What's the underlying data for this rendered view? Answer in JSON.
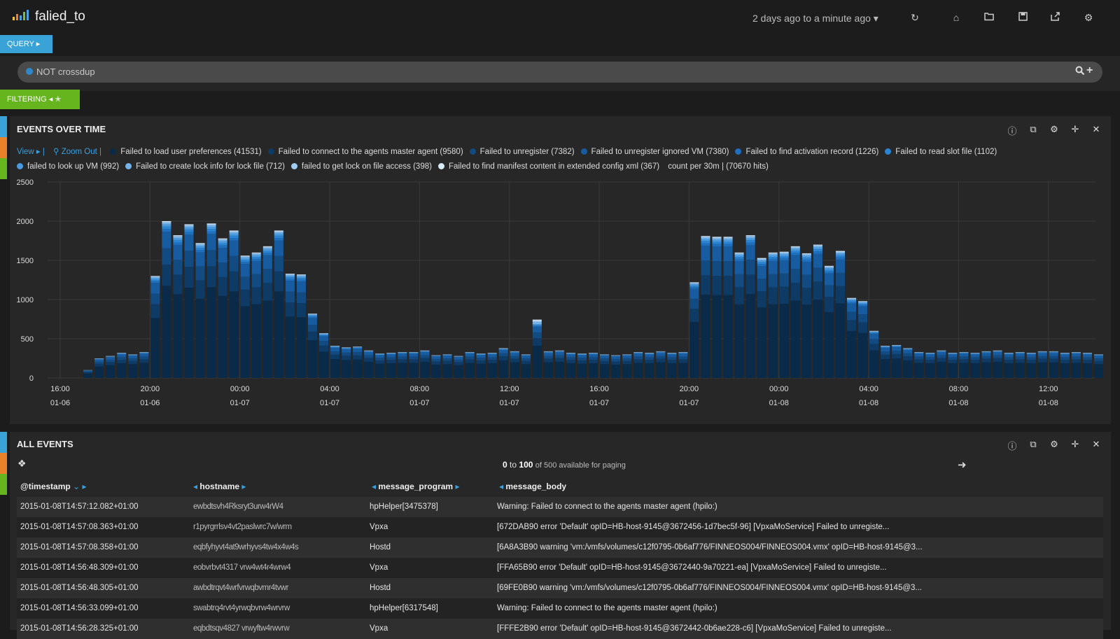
{
  "header": {
    "title": "falied_to",
    "time_range": "2 days ago to a minute ago",
    "icons": [
      "refresh-icon",
      "home-icon",
      "folder-open-icon",
      "save-icon",
      "share-icon",
      "gear-icon"
    ]
  },
  "query": {
    "tab_label": "QUERY",
    "text": "NOT crossdup",
    "color": "#2f88c9"
  },
  "filtering": {
    "tab_label": "FILTERING"
  },
  "events_panel": {
    "title": "EVENTS OVER TIME",
    "view_label": "View",
    "zoom_out_label": "Zoom Out",
    "count_label": "count per 30m | (70670 hits)"
  },
  "chart_data": {
    "type": "bar",
    "stacked": true,
    "title": "",
    "xlabel": "",
    "ylabel": "",
    "ylim": [
      0,
      2500
    ],
    "yticks": [
      0,
      500,
      1000,
      1500,
      2000,
      2500
    ],
    "grid": true,
    "legend_position": "top",
    "x_ticks": [
      {
        "time": "16:00",
        "date": "01-06"
      },
      {
        "time": "20:00",
        "date": "01-06"
      },
      {
        "time": "00:00",
        "date": "01-07"
      },
      {
        "time": "04:00",
        "date": "01-07"
      },
      {
        "time": "08:00",
        "date": "01-07"
      },
      {
        "time": "12:00",
        "date": "01-07"
      },
      {
        "time": "16:00",
        "date": "01-07"
      },
      {
        "time": "20:00",
        "date": "01-07"
      },
      {
        "time": "00:00",
        "date": "01-08"
      },
      {
        "time": "04:00",
        "date": "01-08"
      },
      {
        "time": "08:00",
        "date": "01-08"
      },
      {
        "time": "12:00",
        "date": "01-08"
      }
    ],
    "interval": "30m",
    "start": "2015-01-06 16:00",
    "series": [
      {
        "name": "Failed to load user preferences",
        "count": 41531,
        "color": "#0a2a4a"
      },
      {
        "name": "Failed to connect to the agents master agent",
        "count": 9580,
        "color": "#0e3a66"
      },
      {
        "name": "Failed to unregister",
        "count": 7382,
        "color": "#124a82"
      },
      {
        "name": "Failed to unregister ignored VM",
        "count": 7380,
        "color": "#175ca0"
      },
      {
        "name": "Failed to find activation record",
        "count": 1226,
        "color": "#1e6fbd"
      },
      {
        "name": "Failed to read slot file",
        "count": 1102,
        "color": "#2a84d4"
      },
      {
        "name": "failed to look up VM",
        "count": 992,
        "color": "#4a9ae0"
      },
      {
        "name": "Failed to create lock info for lock file",
        "count": 712,
        "color": "#74b3ea"
      },
      {
        "name": "failed to get lock on file access",
        "count": 398,
        "color": "#a2cdf2"
      },
      {
        "name": "Failed to find manifest content in extended config xml",
        "count": 367,
        "color": "#d6eafa"
      }
    ],
    "totals": [
      0,
      0,
      100,
      250,
      280,
      320,
      300,
      330,
      1300,
      2000,
      1820,
      1960,
      1720,
      1970,
      1780,
      1880,
      1560,
      1600,
      1680,
      1880,
      1330,
      1320,
      820,
      570,
      410,
      390,
      400,
      350,
      310,
      320,
      330,
      330,
      350,
      290,
      300,
      280,
      330,
      310,
      320,
      380,
      340,
      300,
      700,
      340,
      350,
      320,
      310,
      320,
      300,
      290,
      300,
      330,
      320,
      340,
      320,
      330,
      1220,
      1810,
      1800,
      1800,
      1600,
      1820,
      1530,
      1600,
      1610,
      1680,
      1590,
      1700,
      1430,
      1620,
      1020,
      980,
      600,
      410,
      420,
      380,
      330,
      320,
      350,
      320,
      330,
      320,
      340,
      350,
      320,
      330,
      320,
      340,
      340,
      320,
      330,
      320,
      300
    ]
  },
  "events_table": {
    "title": "ALL EVENTS",
    "paging": {
      "from": "0",
      "to_word": "to",
      "to": "100",
      "suffix": "of 500 available for paging"
    },
    "columns": [
      "@timestamp",
      "hostname",
      "message_program",
      "message_body"
    ],
    "rows": [
      {
        "timestamp": "2015-01-08T14:57:12.082+01:00",
        "hostname": "ewbdtsvh4Rksryt3urw4rW4",
        "program": "hpHelper[3475378]",
        "body": "Warning: Failed to connect to the agents master agent (hpilo:)"
      },
      {
        "timestamp": "2015-01-08T14:57:08.363+01:00",
        "hostname": "r1pyrgrrlsv4vt2paslwrc7w/wrm",
        "program": "Vpxa",
        "body": "[672DAB90 error 'Default' opID=HB-host-9145@3672456-1d7bec5f-96] [VpxaMoService] Failed to unregiste..."
      },
      {
        "timestamp": "2015-01-08T14:57:08.358+01:00",
        "hostname": "eqbfyhyvt4at9wrhyvs4tw4x4w4s",
        "program": "Hostd",
        "body": "[6A8A3B90 warning 'vm:/vmfs/volumes/c12f0795-0b6af776/FINNEOS004/FINNEOS004.vmx' opID=HB-host-9145@3..."
      },
      {
        "timestamp": "2015-01-08T14:56:48.309+01:00",
        "hostname": "eobvrbvt4317 vrw4wt4r4wrw4",
        "program": "Vpxa",
        "body": "[FFA65B90 error 'Default' opID=HB-host-9145@3672440-9a70221-ea] [VpxaMoService] Failed to unregiste..."
      },
      {
        "timestamp": "2015-01-08T14:56:48.305+01:00",
        "hostname": "awbdtrqvt4wrfvrwqbvmr4tvwr",
        "program": "Hostd",
        "body": "[69FE0B90 warning 'vm:/vmfs/volumes/c12f0795-0b6af776/FINNEOS004/FINNEOS004.vmx' opID=HB-host-9145@3..."
      },
      {
        "timestamp": "2015-01-08T14:56:33.099+01:00",
        "hostname": "swabtrq4rvt4yrwqbvrw4wrvrw",
        "program": "hpHelper[6317548]",
        "body": "Warning: Failed to connect to the agents master agent (hpilo:)"
      },
      {
        "timestamp": "2015-01-08T14:56:28.325+01:00",
        "hostname": "eqbdtsqv4827 vrwyftw4rwvrw",
        "program": "Vpxa",
        "body": "[FFFE2B90 error 'Default' opID=HB-host-9145@3672442-0b6ae228-c6] [VpxaMoService] Failed to unregiste..."
      }
    ]
  }
}
